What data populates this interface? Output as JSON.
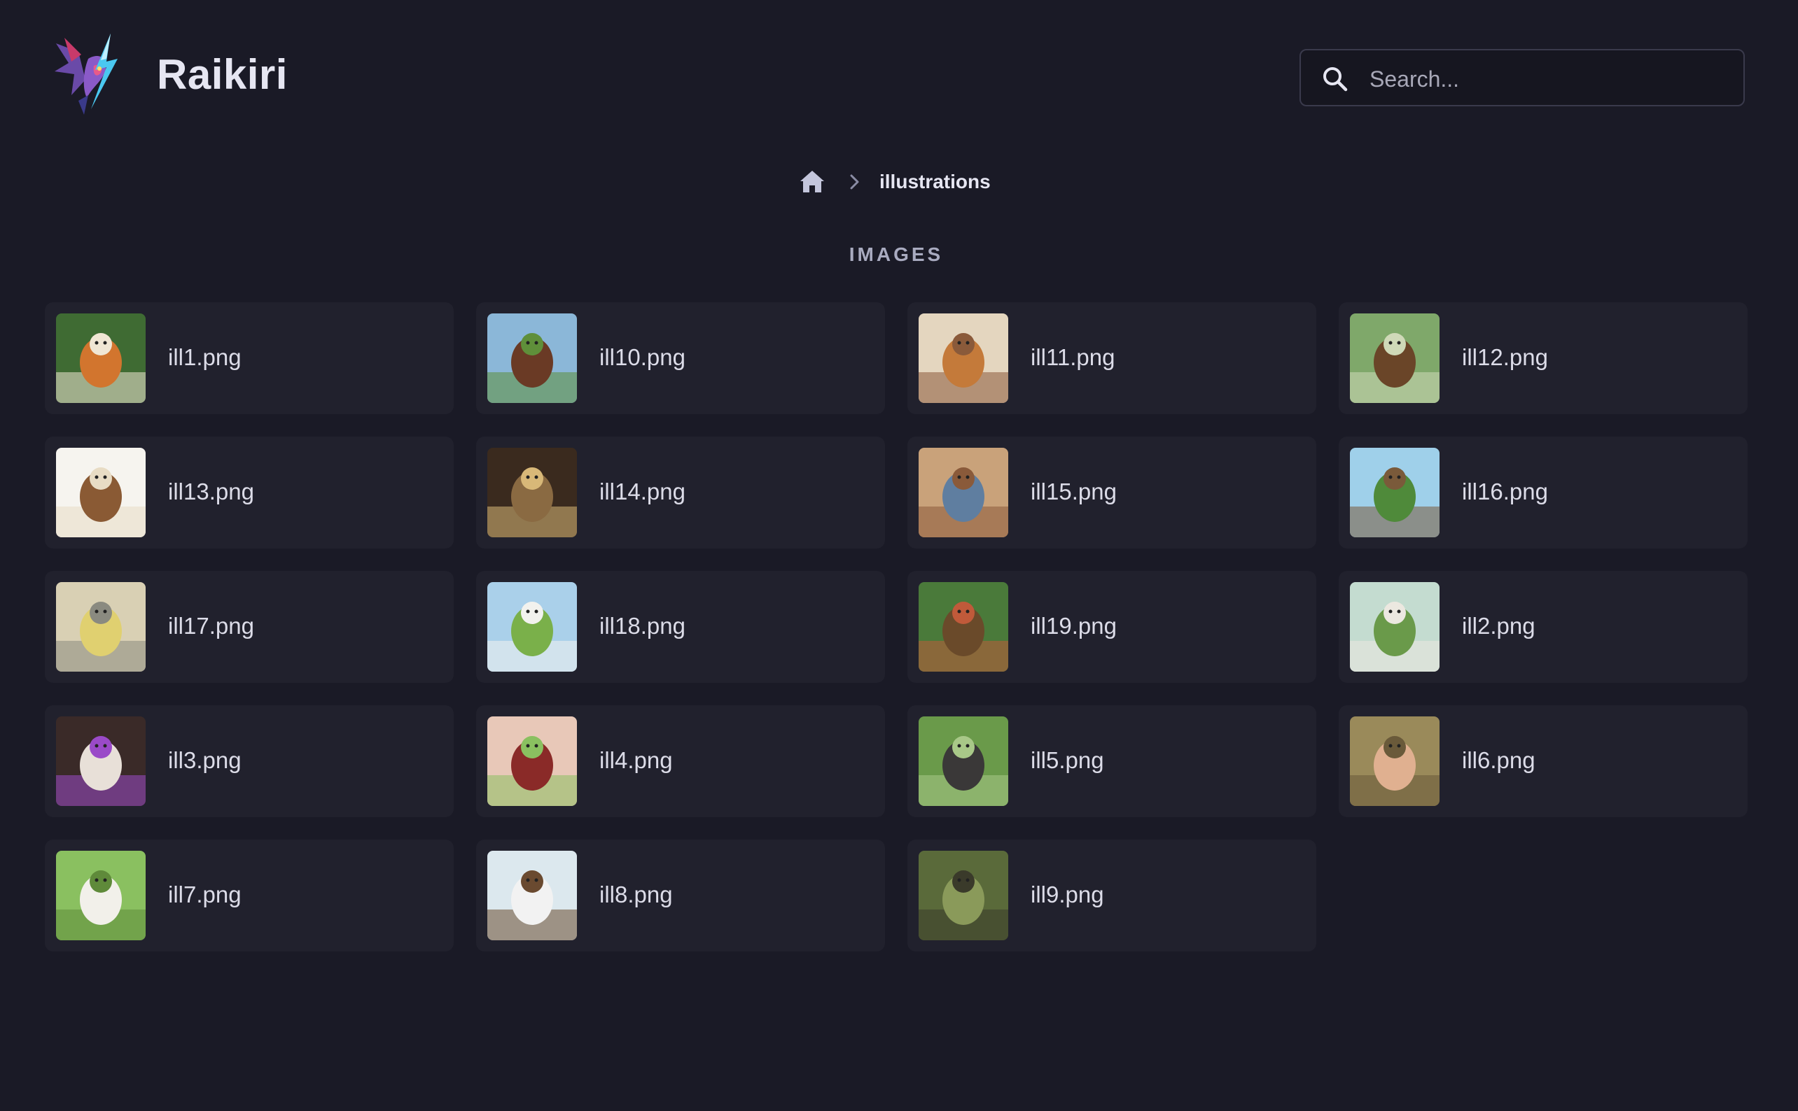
{
  "header": {
    "brand": "Raikiri",
    "search": {
      "placeholder": "Search...",
      "value": ""
    }
  },
  "breadcrumb": {
    "current": "illustrations"
  },
  "section": {
    "title": "IMAGES"
  },
  "images": [
    {
      "name": "ill1.png",
      "colors": [
        "#3f6b33",
        "#d2752e",
        "#f0e6d4"
      ]
    },
    {
      "name": "ill10.png",
      "colors": [
        "#8bb7d8",
        "#6a3a25",
        "#5f8f3a"
      ]
    },
    {
      "name": "ill11.png",
      "colors": [
        "#e4d6bf",
        "#c47a3a",
        "#8a5a3a"
      ]
    },
    {
      "name": "ill12.png",
      "colors": [
        "#7fa86a",
        "#6a4528",
        "#cfd9b8"
      ]
    },
    {
      "name": "ill13.png",
      "colors": [
        "#f6f4ef",
        "#8a5a34",
        "#e8dcc4"
      ]
    },
    {
      "name": "ill14.png",
      "colors": [
        "#3a2a1e",
        "#8a6a42",
        "#d8b878"
      ]
    },
    {
      "name": "ill15.png",
      "colors": [
        "#c9a27a",
        "#5f7ea0",
        "#8a5a3a"
      ]
    },
    {
      "name": "ill16.png",
      "colors": [
        "#9fd0ea",
        "#4f8a3a",
        "#7a5a3a"
      ]
    },
    {
      "name": "ill17.png",
      "colors": [
        "#d9d0b4",
        "#e0d070",
        "#8a8a80"
      ]
    },
    {
      "name": "ill18.png",
      "colors": [
        "#aad0ea",
        "#7ab04a",
        "#f2f2ee"
      ]
    },
    {
      "name": "ill19.png",
      "colors": [
        "#4a7a3a",
        "#6a4a2a",
        "#c05a3a"
      ]
    },
    {
      "name": "ill2.png",
      "colors": [
        "#c4dcd0",
        "#6a9a4a",
        "#ece8e0"
      ]
    },
    {
      "name": "ill3.png",
      "colors": [
        "#3a2a28",
        "#e8e0d8",
        "#9a4ac8"
      ]
    },
    {
      "name": "ill4.png",
      "colors": [
        "#e8c8b8",
        "#8a2a28",
        "#8ac060"
      ]
    },
    {
      "name": "ill5.png",
      "colors": [
        "#6a9a4a",
        "#3a3838",
        "#a8c888"
      ]
    },
    {
      "name": "ill6.png",
      "colors": [
        "#9a8a5a",
        "#e0b090",
        "#6a5a3a"
      ]
    },
    {
      "name": "ill7.png",
      "colors": [
        "#8ac060",
        "#f2f0ea",
        "#5f8a3a"
      ]
    },
    {
      "name": "ill8.png",
      "colors": [
        "#dce8ee",
        "#f2f2f2",
        "#6a4a30"
      ]
    },
    {
      "name": "ill9.png",
      "colors": [
        "#5a6a3a",
        "#8a9a5a",
        "#3a3a2a"
      ]
    }
  ]
}
